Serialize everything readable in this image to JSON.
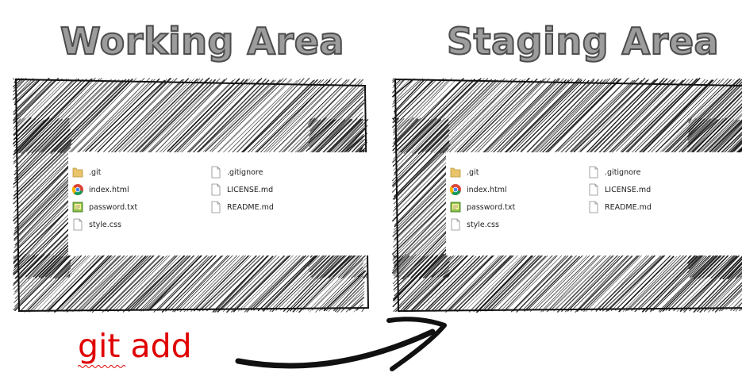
{
  "diagram": {
    "left_area": {
      "title": "Working Area"
    },
    "right_area": {
      "title": "Staging Area"
    },
    "command": {
      "label": "git add",
      "color": "#e00000"
    },
    "files": {
      "column1": [
        {
          "name": ".git",
          "icon": "folder-icon"
        },
        {
          "name": "index.html",
          "icon": "chrome-icon"
        },
        {
          "name": "password.txt",
          "icon": "text-editor-icon"
        },
        {
          "name": "style.css",
          "icon": "document-icon"
        }
      ],
      "column2": [
        {
          "name": ".gitignore",
          "icon": "document-icon"
        },
        {
          "name": "LICENSE.md",
          "icon": "document-icon"
        },
        {
          "name": "README.md",
          "icon": "document-icon"
        }
      ]
    },
    "colors": {
      "heading_fill": "#9c9c9c",
      "heading_outline": "#4d4d4d",
      "sketch": "#111111"
    }
  }
}
